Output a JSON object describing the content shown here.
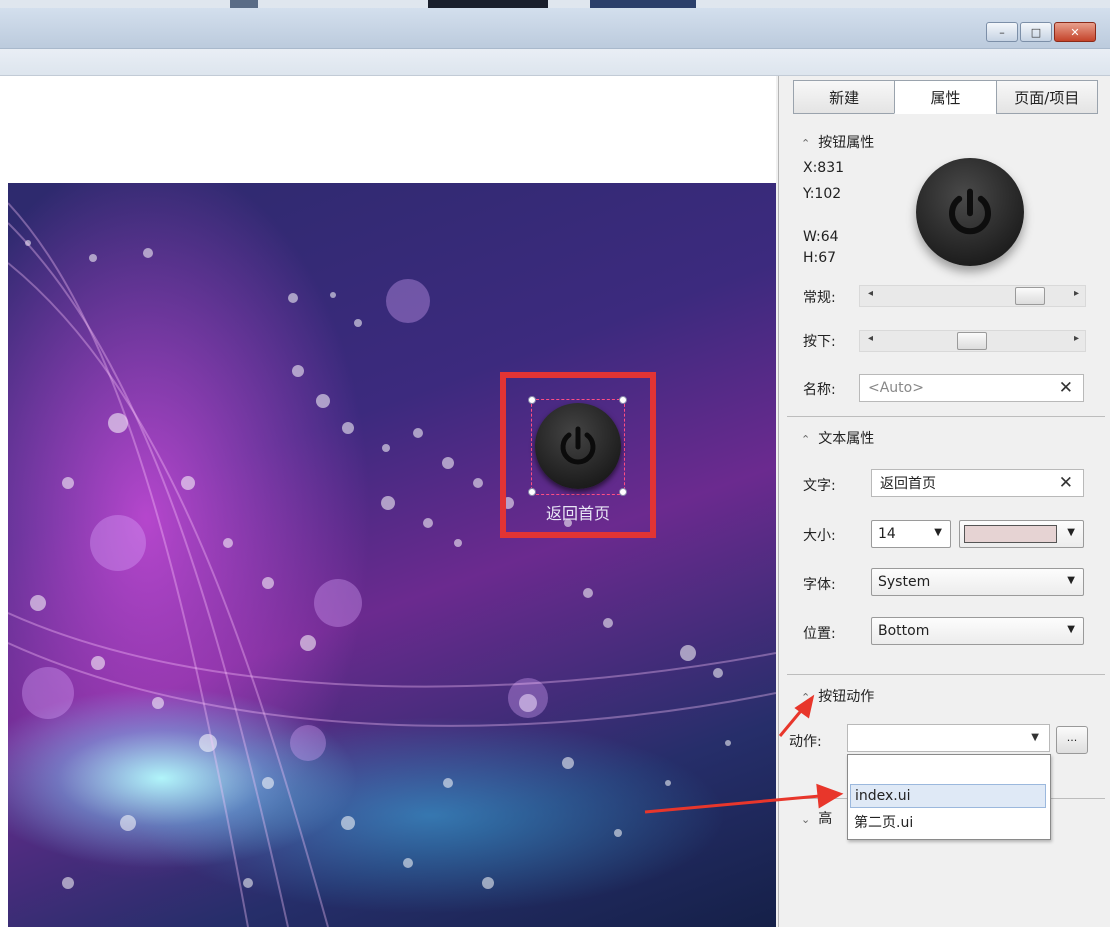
{
  "window": {
    "minimize_label": "–",
    "maximize_label": "□",
    "close_label": "✕"
  },
  "canvas": {
    "button_caption": "返回首页"
  },
  "panel": {
    "tabs": [
      {
        "label": "新建"
      },
      {
        "label": "属性"
      },
      {
        "label": "页面/项目"
      }
    ],
    "button_props": {
      "title": "按钮属性",
      "x": "X:831",
      "y": "Y:102",
      "w": "W:64",
      "h": "H:67",
      "normal_label": "常规:",
      "pressed_label": "按下:",
      "normal_level": 0.88,
      "pressed_level": 0.5,
      "name_label": "名称:",
      "name_placeholder": "<Auto>"
    },
    "text_props": {
      "title": "文本属性",
      "text_label": "文字:",
      "text_value": "返回首页",
      "size_label": "大小:",
      "size_value": "14",
      "color_value": "#e6d3d3",
      "font_label": "字体:",
      "font_value": "System",
      "position_label": "位置:",
      "position_value": "Bottom"
    },
    "button_action": {
      "title": "按钮动作",
      "action_label": "动作:",
      "action_value": "",
      "more_button": "...",
      "options": [
        "",
        "index.ui",
        "第二页.ui"
      ]
    },
    "advanced": {
      "title_fragment": "高"
    }
  },
  "colors": {
    "highlight_box": "#e23434",
    "arrow": "#e8362b",
    "selection_border": "#ff4e84"
  }
}
